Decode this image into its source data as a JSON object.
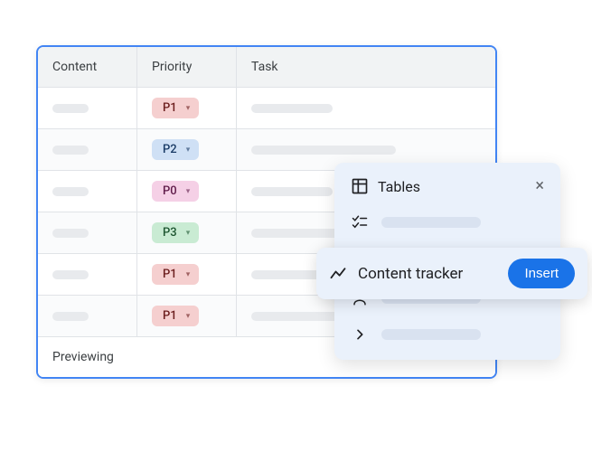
{
  "table": {
    "headers": {
      "content": "Content",
      "priority": "Priority",
      "task": "Task"
    },
    "rows": [
      {
        "priority": "P1",
        "chipClass": "chip-p1",
        "taskLen": "short"
      },
      {
        "priority": "P2",
        "chipClass": "chip-p2",
        "taskLen": "long"
      },
      {
        "priority": "P0",
        "chipClass": "chip-p0",
        "taskLen": "short"
      },
      {
        "priority": "P3",
        "chipClass": "chip-p3",
        "taskLen": "long"
      },
      {
        "priority": "P1",
        "chipClass": "chip-p1",
        "taskLen": "short"
      },
      {
        "priority": "P1",
        "chipClass": "chip-p1",
        "taskLen": "long"
      }
    ],
    "footer": "Previewing"
  },
  "panel": {
    "title": "Tables",
    "highlighted": {
      "label": "Content tracker",
      "action": "Insert"
    }
  }
}
